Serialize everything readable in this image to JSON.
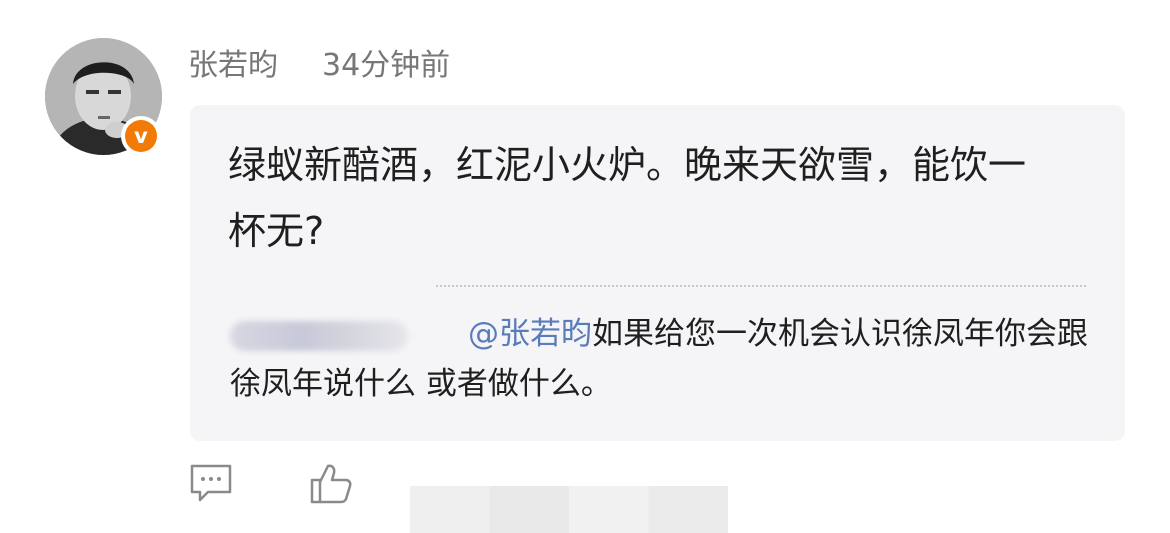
{
  "comment": {
    "author": "张若昀",
    "time": "34分钟前",
    "verified_badge": "v",
    "content": "绿蚁新醅酒，红泥小火炉。晚来天欲雪，能饮一杯无?",
    "reply": {
      "mention": "@张若昀",
      "text": "如果给您一次机会认识徐凤年你会跟徐凤年说什么 或者做什么。"
    }
  },
  "actions": {
    "comment_icon": "comment-icon",
    "like_icon": "thumbs-up-icon"
  },
  "colors": {
    "card_background": "#f5f5f7",
    "mention": "#5a7dba",
    "verified": "#f27a07",
    "meta_text": "#777777"
  }
}
